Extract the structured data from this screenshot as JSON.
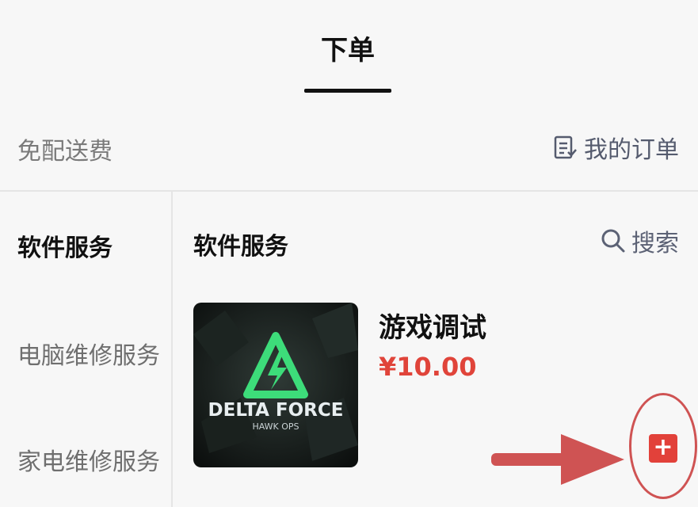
{
  "header": {
    "tab_label": "下单"
  },
  "info": {
    "shipping": "免配送费",
    "my_orders": "我的订单"
  },
  "sidebar": {
    "items": [
      {
        "label": "软件服务",
        "active": true
      },
      {
        "label": "电脑维修服务",
        "active": false
      },
      {
        "label": "家电维修服务",
        "active": false
      }
    ]
  },
  "content": {
    "section_title": "软件服务",
    "search_label": "搜索",
    "product": {
      "name": "游戏调试",
      "price": "¥10.00",
      "image_text_main": "DELTA FORCE",
      "image_text_sub": "HAWK OPS"
    },
    "add_button_symbol": "+"
  },
  "colors": {
    "price": "#e0443a",
    "add_button": "#e2413a",
    "annotation": "#cf5353",
    "logo_green": "#3ddc7a"
  }
}
